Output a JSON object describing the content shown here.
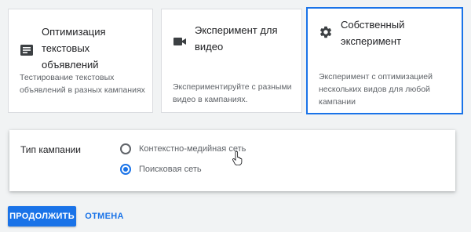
{
  "experiment_types": [
    {
      "title": "Оптимизация текстовых объявлений",
      "description": "Тестирование текстовых объявлений в разных кампаниях",
      "icon": "text-lines-icon",
      "selected": false
    },
    {
      "title": "Эксперимент для видео",
      "description": "Экспериментируйте с разными видео в кампаниях.",
      "icon": "videocam-icon",
      "selected": false
    },
    {
      "title": "Собственный эксперимент",
      "description": "Эксперимент с оптимизацией нескольких видов для любой кампании",
      "icon": "gear-icon",
      "selected": true
    }
  ],
  "campaign_type": {
    "label": "Тип кампании",
    "options": [
      {
        "label": "Контекстно-медийная сеть",
        "checked": false
      },
      {
        "label": "Поисковая сеть",
        "checked": true
      }
    ]
  },
  "actions": {
    "continue_label": "ПРОДОЛЖИТЬ",
    "cancel_label": "ОТМЕНА"
  },
  "colors": {
    "accent": "#1a73e8",
    "background": "#f1f3f4"
  }
}
